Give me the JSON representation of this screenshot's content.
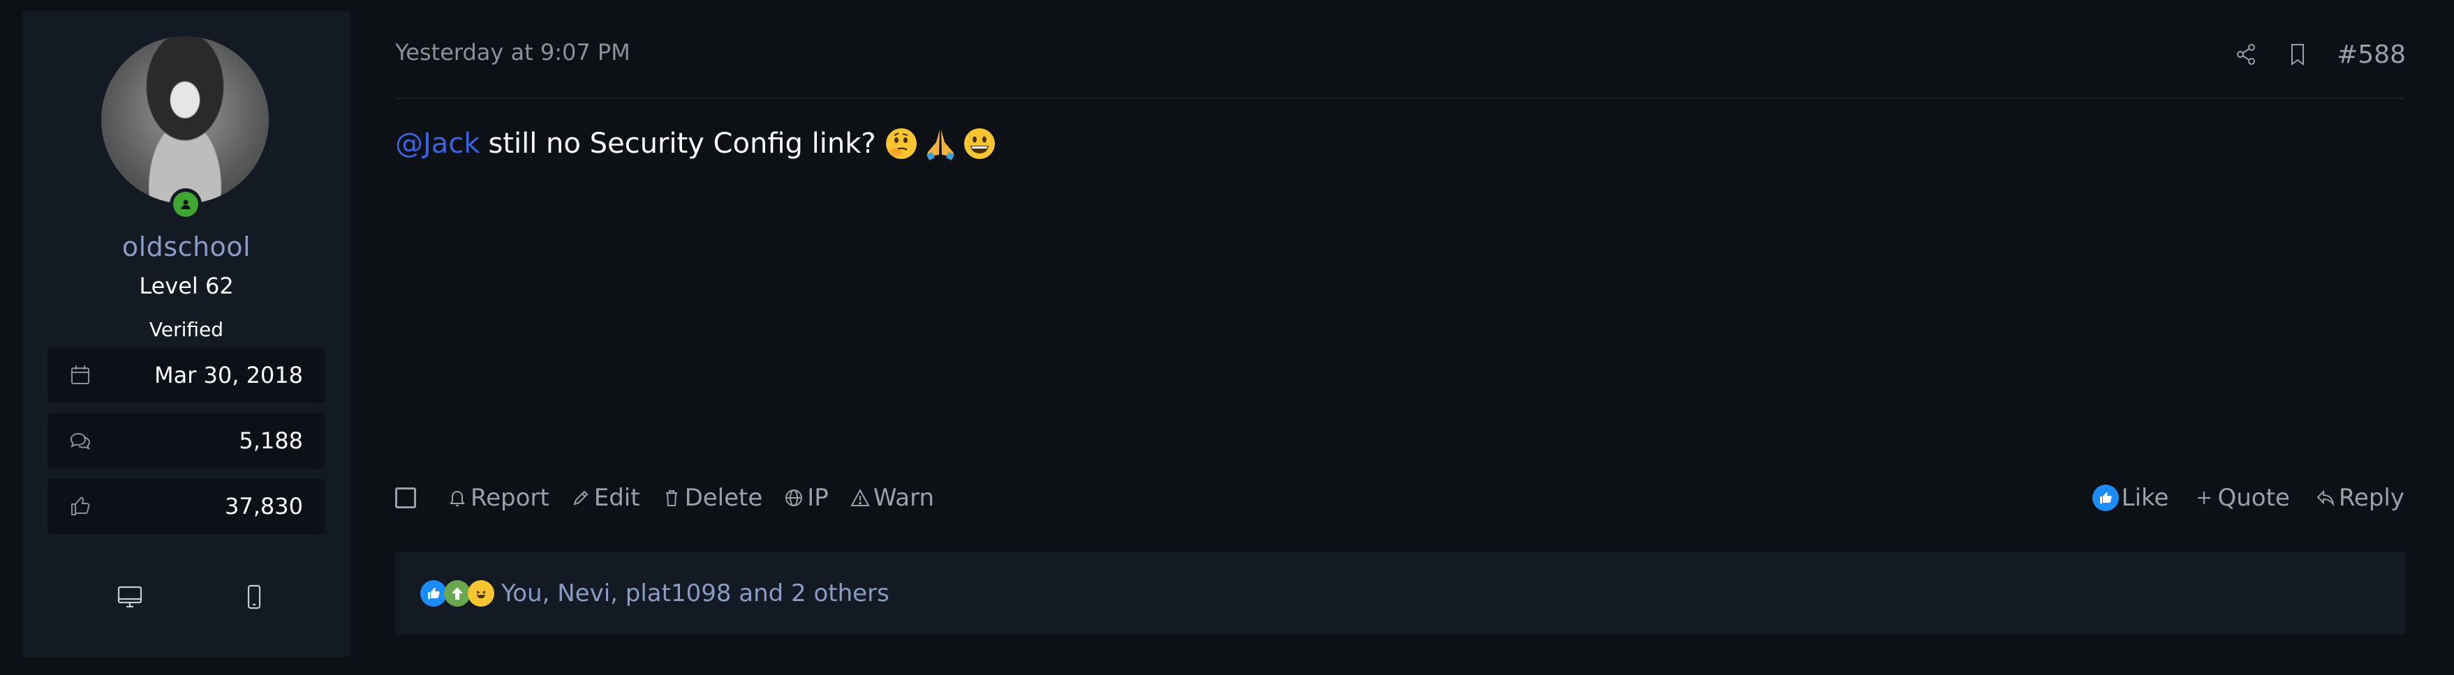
{
  "author": {
    "username": "oldschool",
    "level": "Level 62",
    "badge": "Verified",
    "stats": [
      {
        "icon": "calendar-icon",
        "value": "Mar 30, 2018"
      },
      {
        "icon": "messages-icon",
        "value": "5,188"
      },
      {
        "icon": "thumbs-up-icon",
        "value": "37,830"
      }
    ],
    "devices": [
      "desktop-icon",
      "mobile-icon"
    ],
    "online_color": "#3fa631"
  },
  "post": {
    "date": "Yesterday at 9:07 PM",
    "number": "#588",
    "mention": "@Jack",
    "text": "still no Security Config link?",
    "emojis": [
      "thinking-face-icon",
      "folded-hands-icon",
      "grinning-face-icon"
    ]
  },
  "actions": {
    "left": [
      "Report",
      "Edit",
      "Delete",
      "IP",
      "Warn"
    ],
    "like": "Like",
    "quote": "Quote",
    "reply": "Reply"
  },
  "reactions": {
    "icons": [
      "like-reaction-icon",
      "upvote-reaction-icon",
      "laugh-reaction-icon"
    ],
    "summary": "You, Nevi, plat1098 and 2 others"
  },
  "colors": {
    "background": "#0d1014",
    "panel": "#131a24",
    "accent_link": "#3b62e0",
    "muted_text": "#9aa1ab",
    "like_blue": "#1d8cf8"
  }
}
